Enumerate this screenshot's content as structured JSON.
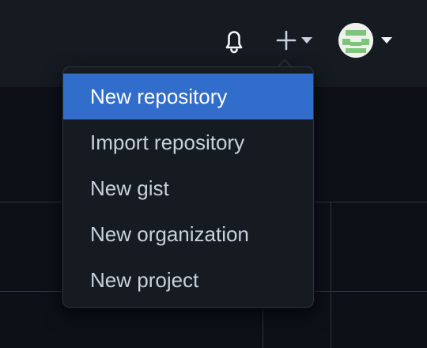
{
  "header": {
    "icons": {
      "notifications": "bell-icon",
      "create": "plus-icon",
      "create_caret": "caret-down-icon",
      "avatar": "avatar-image",
      "avatar_caret": "caret-down-icon"
    }
  },
  "create_menu": {
    "items": [
      {
        "label": "New repository",
        "active": true
      },
      {
        "label": "Import repository",
        "active": false
      },
      {
        "label": "New gist",
        "active": false
      },
      {
        "label": "New organization",
        "active": false
      },
      {
        "label": "New project",
        "active": false
      }
    ]
  },
  "colors": {
    "page_background": "#0d1117",
    "header_background": "#161b22",
    "menu_background": "#161b22",
    "menu_border": "#30363d",
    "active_item": "#316dca",
    "text": "#c9d1d9",
    "avatar_green": "#7cc57a"
  }
}
